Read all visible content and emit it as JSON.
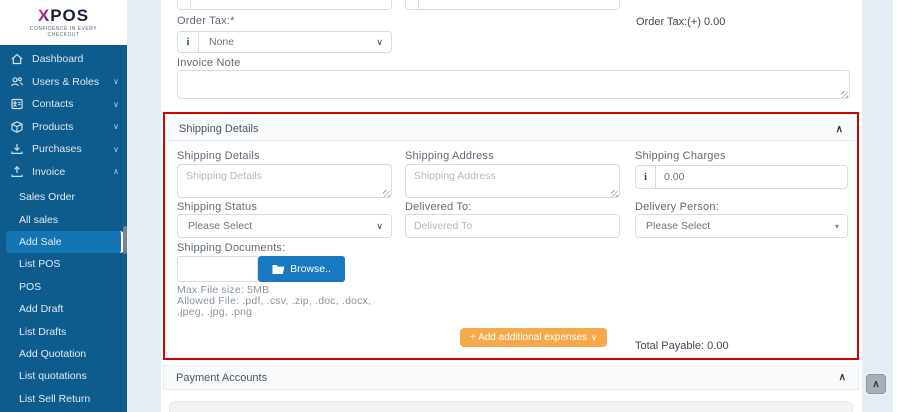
{
  "colors": {
    "sidebar_bg": "#0e5c8d",
    "sidebar_active_bg": "#1475b5",
    "page_bg": "#e4eef4",
    "annotation_red": "#d60000",
    "browse_blue": "#1878c2",
    "expenses_orange": "#f5a94b"
  },
  "icons": {
    "chevron_down": "∨",
    "chevron_up": "∧",
    "select_caret": "▾",
    "info": "i",
    "scroll_top": "∧"
  },
  "logo": {
    "brand_x": "X",
    "brand_rest": "POS",
    "tagline": "CONFIDENCE IN EVERY CHECKOUT"
  },
  "sidebar": {
    "items": [
      {
        "label": "Dashboard"
      },
      {
        "label": "Users & Roles"
      },
      {
        "label": "Contacts"
      },
      {
        "label": "Products"
      },
      {
        "label": "Purchases"
      },
      {
        "label": "Invoice"
      }
    ],
    "submenu": [
      "Sales Order",
      "All sales",
      "Add Sale",
      "List POS",
      "POS",
      "Add Draft",
      "List Drafts",
      "Add Quotation",
      "List quotations",
      "List Sell Return"
    ],
    "active_item": "Add Sale"
  },
  "main": {
    "order_tax": {
      "label": "Order Tax:*",
      "selected": "None",
      "summary": "Order Tax:(+) 0.00"
    },
    "invoice_note_label": "Invoice Note",
    "shipping": {
      "title": "Shipping Details",
      "details_label": "Shipping Details",
      "details_placeholder": "Shipping Details",
      "address_label": "Shipping Address",
      "address_placeholder": "Shipping Address",
      "charges_label": "Shipping Charges",
      "charges_value": "0.00",
      "status_label": "Shipping Status",
      "status_selected": "Please Select",
      "delivered_label": "Delivered To:",
      "delivered_placeholder": "Delivered To",
      "person_label": "Delivery Person:",
      "person_selected": "Please Select",
      "documents_label": "Shipping Documents:",
      "browse_label": "Browse..",
      "max_file": "Max File size: 5MB",
      "allowed_line1": "Allowed File: .pdf, .csv, .zip, .doc, .docx,",
      "allowed_line2": ".jpeg, .jpg, .png",
      "add_expenses": "+ Add additional expenses",
      "total_payable": "Total Payable: 0.00"
    },
    "payment_accounts_title": "Payment Accounts"
  }
}
